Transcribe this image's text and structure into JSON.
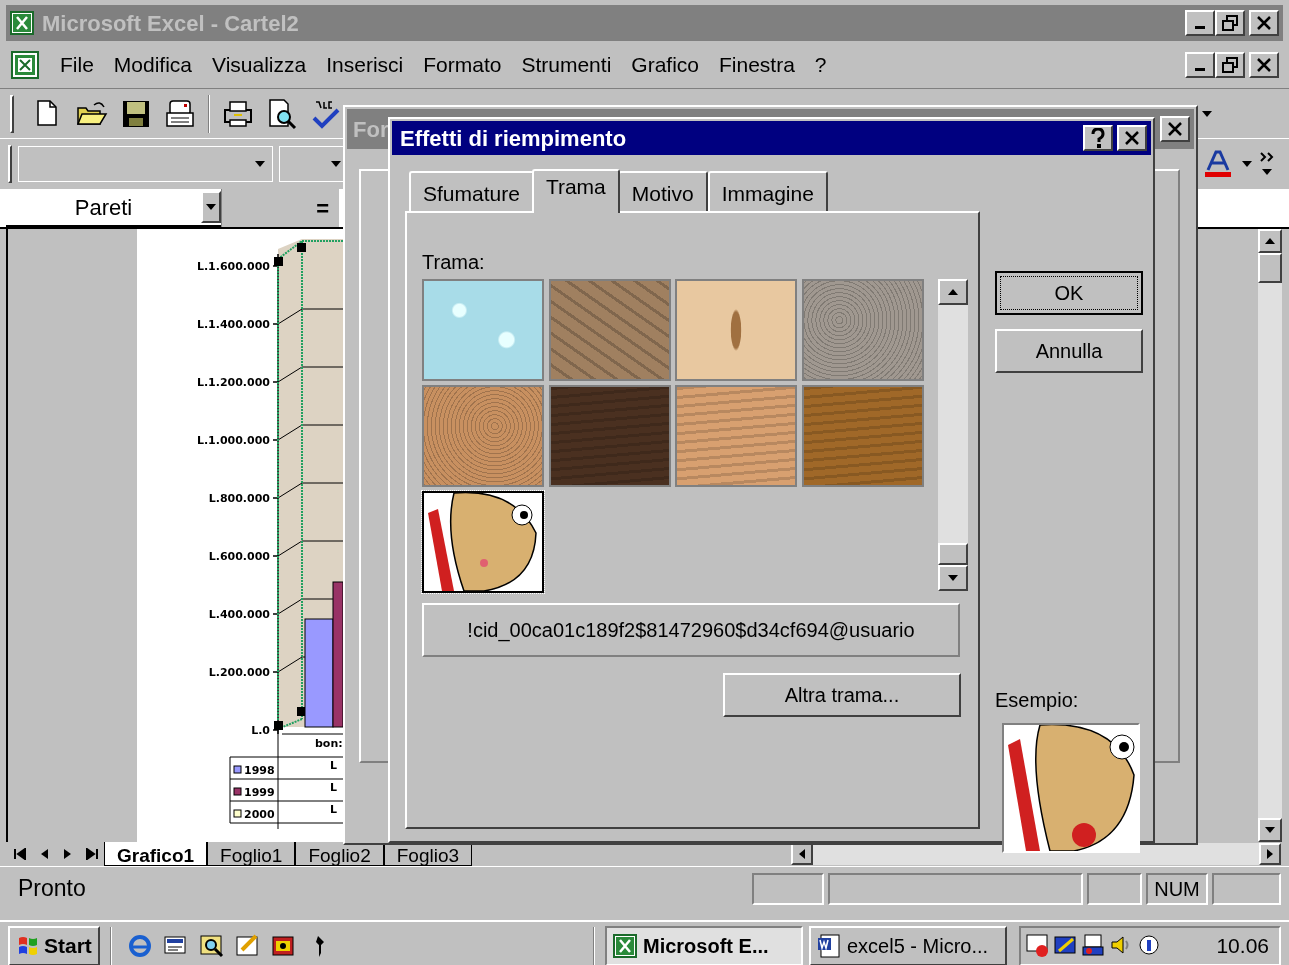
{
  "window": {
    "title": "Microsoft Excel - Cartel2"
  },
  "menu": [
    "File",
    "Modifica",
    "Visualizza",
    "Inserisci",
    "Formato",
    "Strumenti",
    "Grafico",
    "Finestra",
    "?"
  ],
  "toolbar": [
    {
      "kind": "new"
    },
    {
      "kind": "open"
    },
    {
      "kind": "save"
    },
    {
      "kind": "mail"
    },
    {
      "kind": "sep"
    },
    {
      "kind": "print"
    },
    {
      "kind": "preview"
    },
    {
      "kind": "spell"
    }
  ],
  "name_box": {
    "value": "Pareti",
    "equals": "="
  },
  "chart": {
    "axis_labels": [
      "L.1.600.000",
      "L.1.400.000",
      "L.1.200.000",
      "L.1.000.000",
      "L.800.000",
      "L.600.000",
      "L.400.000",
      "L.200.000",
      "L.0"
    ],
    "category_label": "bon:",
    "legend": [
      {
        "label": "1998",
        "color": "#9999ff",
        "cell": "L"
      },
      {
        "label": "1999",
        "color": "#993366",
        "cell": "L"
      },
      {
        "label": "2000",
        "color": "#ffffcc",
        "cell": "L"
      }
    ]
  },
  "sheet_tabs": [
    {
      "label": "Grafico1",
      "selected": true
    },
    {
      "label": "Foglio1",
      "selected": false
    },
    {
      "label": "Foglio2",
      "selected": false
    },
    {
      "label": "Foglio3",
      "selected": false
    }
  ],
  "status_bar": {
    "text": "Pronto",
    "indicator": "NUM"
  },
  "back_dialog": {
    "title": "For"
  },
  "dialog": {
    "title": "Effetti di riempimento",
    "tabs": [
      {
        "label": "Sfumature",
        "selected": false
      },
      {
        "label": "Trama",
        "selected": true
      },
      {
        "label": "Motivo",
        "selected": false
      },
      {
        "label": "Immagine",
        "selected": false
      }
    ],
    "texture_label": "Trama:",
    "textures": [
      {
        "kind": "drops",
        "color": "#a8dce8",
        "selected": false
      },
      {
        "kind": "paper",
        "color": "#a08060",
        "selected": false
      },
      {
        "kind": "fossil",
        "color": "#e8c8a0",
        "selected": false
      },
      {
        "kind": "granite",
        "color": "#a09890",
        "selected": false
      },
      {
        "kind": "cork",
        "color": "#c89060",
        "selected": false
      },
      {
        "kind": "wood",
        "color": "#4a3020",
        "selected": false
      },
      {
        "kind": "wood",
        "color": "#d8a070",
        "selected": false
      },
      {
        "kind": "wood",
        "color": "#a06828",
        "selected": false
      },
      {
        "kind": "picture",
        "color": "#d8b070",
        "selected": true
      }
    ],
    "texture_name": "!cid_00ca01c189f2$81472960$d34cf694@usuario",
    "other_button": "Altra trama...",
    "ok": "OK",
    "cancel": "Annulla",
    "sample_label": "Esempio:"
  },
  "taskbar": {
    "start": "Start",
    "quick_launch": [
      {
        "kind": "browser"
      },
      {
        "kind": "desktop"
      },
      {
        "kind": "search"
      },
      {
        "kind": "notes"
      },
      {
        "kind": "media"
      },
      {
        "kind": "pin"
      }
    ],
    "tasks": [
      {
        "label": "Microsoft E...",
        "selected": true,
        "kind": "excel"
      },
      {
        "label": "excel5 - Micro...",
        "selected": false,
        "kind": "word"
      }
    ],
    "clock": "10.06"
  }
}
